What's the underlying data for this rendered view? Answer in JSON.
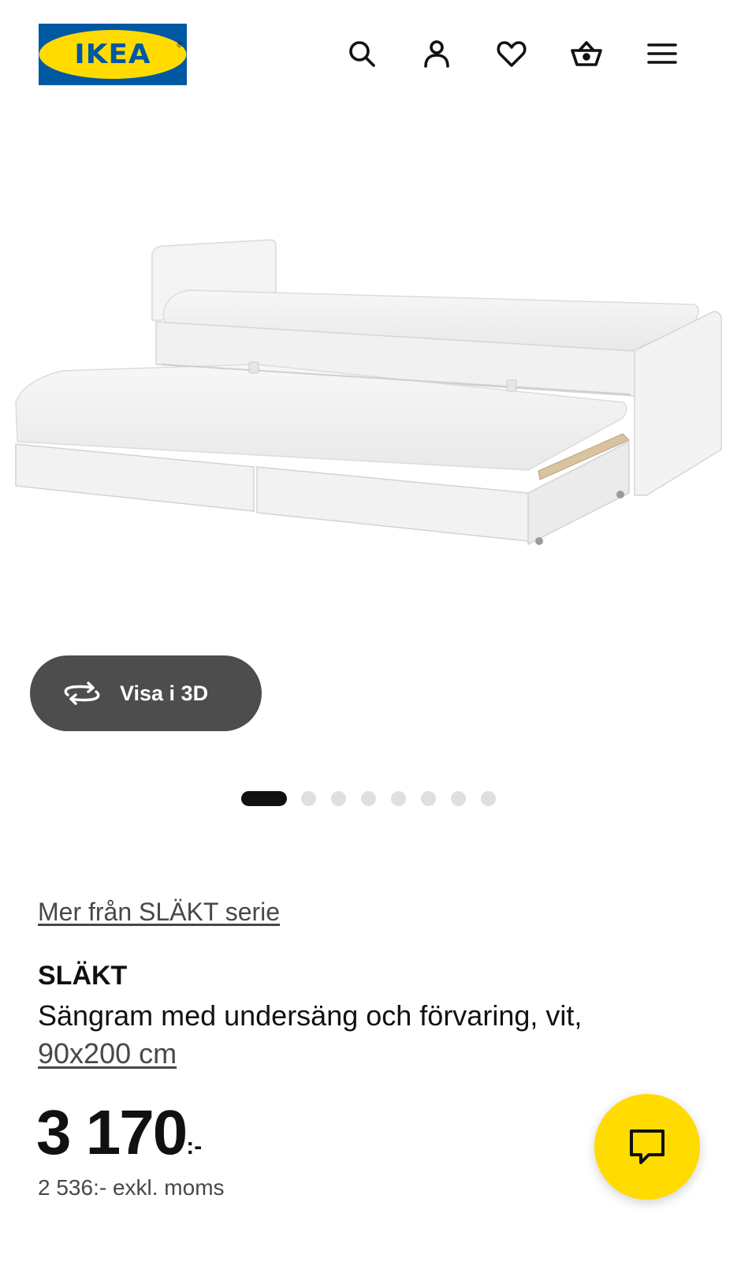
{
  "header": {
    "logo_text": "IKEA",
    "logo_reg": "®",
    "brand_colors": {
      "blue": "#0058a3",
      "yellow": "#ffdb00"
    },
    "icons": [
      "search-icon",
      "user-icon",
      "heart-icon",
      "basket-icon",
      "menu-icon"
    ]
  },
  "gallery": {
    "view_3d_label": "Visa i 3D",
    "image_count": 8,
    "active_index": 0
  },
  "product": {
    "series_link": "Mer från SLÄKT serie",
    "name": "SLÄKT",
    "description": "Sängram med undersäng och förvaring, vit,",
    "size": "90x200 cm",
    "price": "3 170",
    "price_suffix": ":-",
    "price_excl_vat": "2 536:- exkl. moms"
  },
  "chat": {
    "icon": "chat-icon",
    "color": "#ffdb00"
  }
}
